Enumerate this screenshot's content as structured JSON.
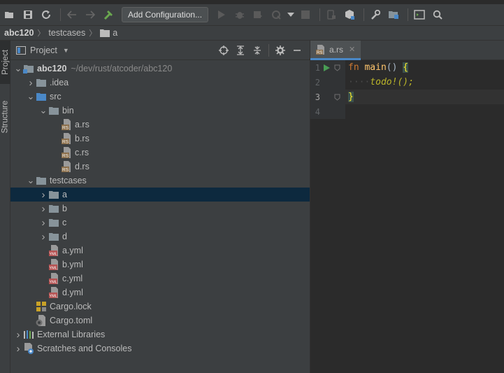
{
  "toolbar": {
    "config_button_label": "Add Configuration...",
    "icons": [
      "open-folder-icon",
      "save-icon",
      "sync-icon",
      "back-icon",
      "forward-icon",
      "build-icon",
      "run-icon",
      "debug-icon",
      "coverage-icon",
      "profile-icon",
      "run-dropdown-icon",
      "stop-icon",
      "device-icon",
      "deploy-icon",
      "settings-wrench-icon",
      "project-structure-icon",
      "terminal-icon",
      "search-icon"
    ]
  },
  "breadcrumb": {
    "items": [
      "abc120",
      "testcases",
      "a"
    ]
  },
  "sidestrip": {
    "project_tab": "Project",
    "structure_tab": "Structure"
  },
  "project_panel": {
    "title": "Project",
    "tree": [
      {
        "label": "abc120",
        "path": "~/dev/rust/atcoder/abc120",
        "type": "module",
        "depth": 0,
        "expanded": true
      },
      {
        "label": ".idea",
        "type": "folder",
        "depth": 1,
        "expanded": false
      },
      {
        "label": "src",
        "type": "src-folder",
        "depth": 1,
        "expanded": true
      },
      {
        "label": "bin",
        "type": "folder",
        "depth": 2,
        "expanded": true
      },
      {
        "label": "a.rs",
        "type": "rs",
        "depth": 3
      },
      {
        "label": "b.rs",
        "type": "rs",
        "depth": 3
      },
      {
        "label": "c.rs",
        "type": "rs",
        "depth": 3
      },
      {
        "label": "d.rs",
        "type": "rs",
        "depth": 3
      },
      {
        "label": "testcases",
        "type": "folder",
        "depth": 1,
        "expanded": true
      },
      {
        "label": "a",
        "type": "folder",
        "depth": 2,
        "expanded": false,
        "selected": true
      },
      {
        "label": "b",
        "type": "folder",
        "depth": 2,
        "expanded": false
      },
      {
        "label": "c",
        "type": "folder",
        "depth": 2,
        "expanded": false
      },
      {
        "label": "d",
        "type": "folder",
        "depth": 2,
        "expanded": false
      },
      {
        "label": "a.yml",
        "type": "yml",
        "depth": 2
      },
      {
        "label": "b.yml",
        "type": "yml",
        "depth": 2
      },
      {
        "label": "c.yml",
        "type": "yml",
        "depth": 2
      },
      {
        "label": "d.yml",
        "type": "yml",
        "depth": 2
      },
      {
        "label": "Cargo.lock",
        "type": "lock",
        "depth": 1
      },
      {
        "label": "Cargo.toml",
        "type": "toml",
        "depth": 1
      },
      {
        "label": "External Libraries",
        "type": "libraries",
        "depth": 0,
        "expanded": false
      },
      {
        "label": "Scratches and Consoles",
        "type": "scratches",
        "depth": 0,
        "expanded": false
      }
    ]
  },
  "editor": {
    "tab_label": "a.rs",
    "lines": [
      {
        "num": "1",
        "tokens": [
          [
            "kw",
            "fn"
          ],
          [
            "punc",
            " "
          ],
          [
            "fn",
            "main"
          ],
          [
            "punc",
            "() "
          ],
          [
            "brace",
            "{"
          ]
        ]
      },
      {
        "num": "2",
        "tokens": [
          [
            "indent",
            "····"
          ],
          [
            "mac",
            "todo!"
          ],
          [
            "mac",
            "();"
          ]
        ]
      },
      {
        "num": "3",
        "tokens": [
          [
            "brace",
            "}"
          ]
        ]
      },
      {
        "num": "4",
        "tokens": []
      }
    ]
  },
  "colors": {
    "selection": "#0d293e",
    "tab_underline": "#4a88c7",
    "run_green": "#499c54",
    "folder_blue": "#87939a",
    "rs_icon": "#8b6e4a",
    "yml_icon": "#b55353"
  }
}
